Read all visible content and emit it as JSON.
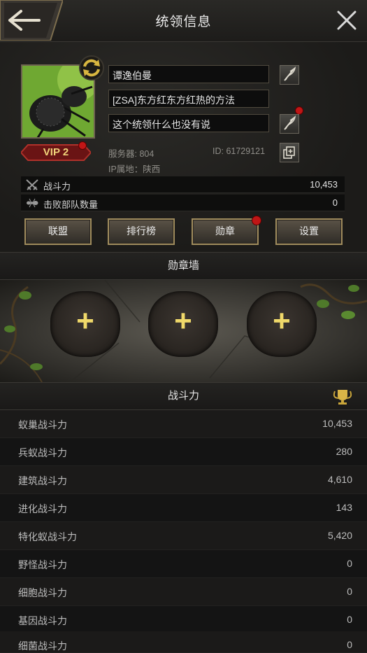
{
  "header": {
    "title": "统领信息"
  },
  "profile": {
    "name": "谭逸伯曼",
    "alliance_name": "[ZSA]东方红东方红热的方法",
    "motto": "这个统领什么也没有说",
    "vip": "VIP 2",
    "server": "服务器: 804",
    "player_id": "ID: 61729121",
    "ip_location": "IP属地：陕西",
    "stats": [
      {
        "label": "战斗力",
        "value": "10,453",
        "icon": "crossed-swords-icon"
      },
      {
        "label": "击败部队数量",
        "value": "0",
        "icon": "ant-icon"
      }
    ]
  },
  "buttons": {
    "alliance": "联盟",
    "ranking": "排行榜",
    "medal": "勋章",
    "settings": "设置"
  },
  "medal_wall": {
    "title": "勋章墙",
    "slots": [
      "+",
      "+",
      "+"
    ]
  },
  "power": {
    "title": "战斗力",
    "rows": [
      {
        "label": "蚁巢战斗力",
        "value": "10,453"
      },
      {
        "label": "兵蚁战斗力",
        "value": "280"
      },
      {
        "label": "建筑战斗力",
        "value": "4,610"
      },
      {
        "label": "进化战斗力",
        "value": "143"
      },
      {
        "label": "特化蚁战斗力",
        "value": "5,420"
      },
      {
        "label": "野怪战斗力",
        "value": "0"
      },
      {
        "label": "细胞战斗力",
        "value": "0"
      },
      {
        "label": "基因战斗力",
        "value": "0"
      },
      {
        "label": "细菌战斗力",
        "value": "0"
      }
    ]
  },
  "colors": {
    "accent_gold": "#f0d96a",
    "notification_red": "#c01616"
  }
}
